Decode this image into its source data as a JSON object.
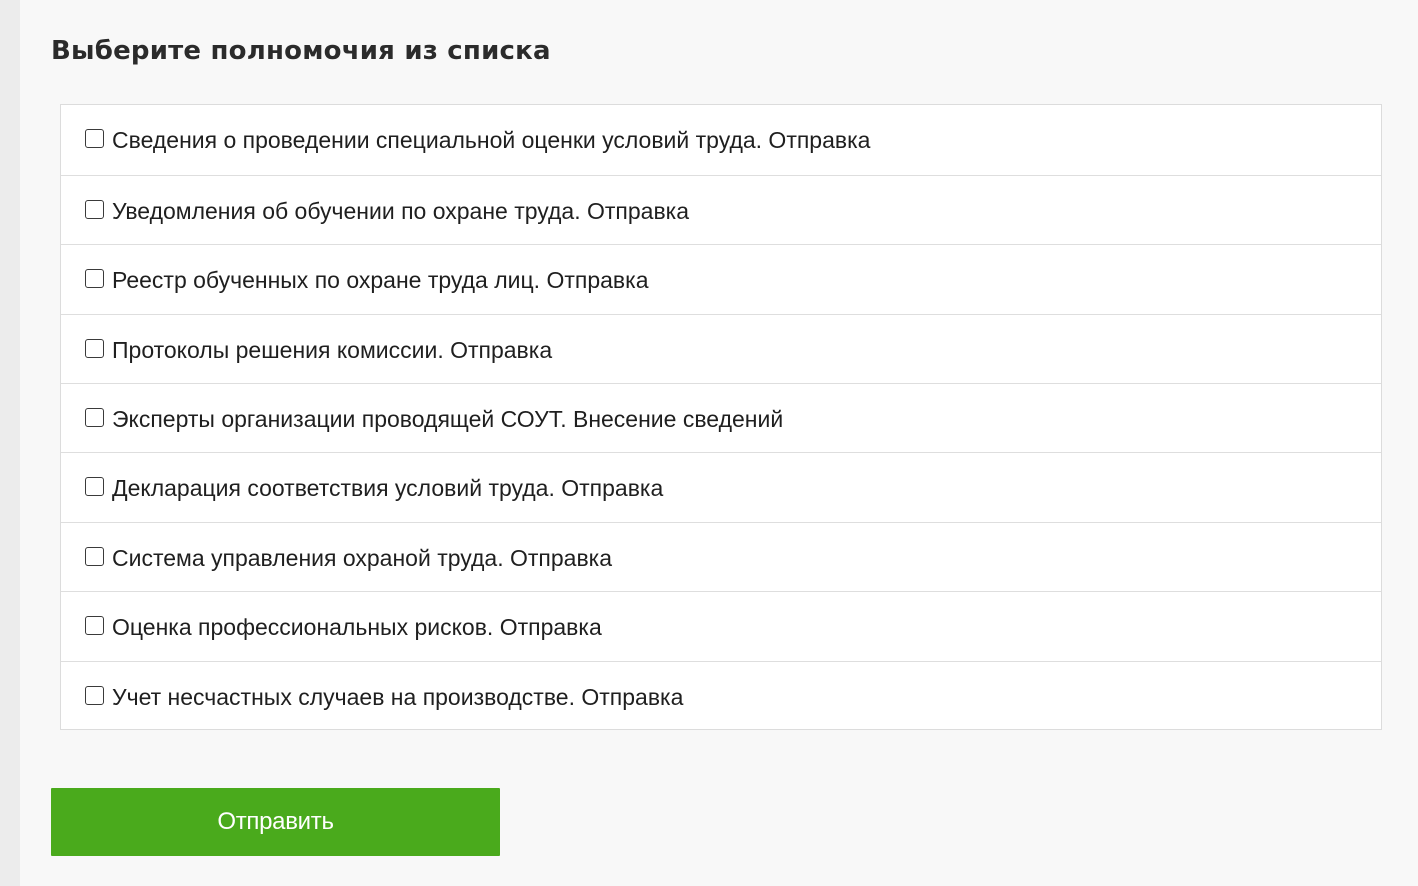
{
  "page_title": "Выберите полномочия из списка",
  "permissions": [
    {
      "label": "Сведения о проведении специальной оценки условий труда. Отправка",
      "checked": false
    },
    {
      "label": "Уведомления об обучении по охране труда. Отправка",
      "checked": false
    },
    {
      "label": "Реестр обученных по охране труда лиц. Отправка",
      "checked": false
    },
    {
      "label": "Протоколы решения комиссии. Отправка",
      "checked": false
    },
    {
      "label": "Эксперты организации проводящей СОУТ. Внесение сведений",
      "checked": false
    },
    {
      "label": "Декларация соответствия условий труда. Отправка",
      "checked": false
    },
    {
      "label": "Система управления охраной труда. Отправка",
      "checked": false
    },
    {
      "label": "Оценка профессиональных рисков. Отправка",
      "checked": false
    },
    {
      "label": "Учет несчастных случаев на производстве. Отправка",
      "checked": false
    }
  ],
  "submit_label": "Отправить",
  "colors": {
    "submit_button": "#4aaa1c",
    "background": "#f8f8f8"
  }
}
